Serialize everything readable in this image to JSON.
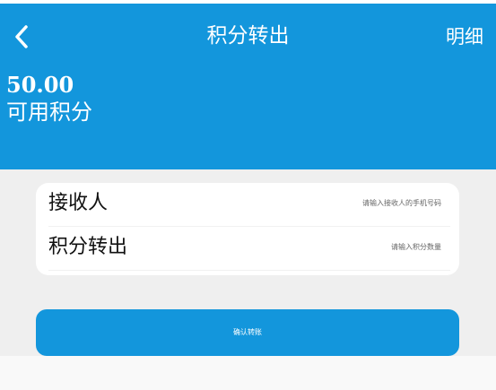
{
  "header": {
    "back_icon": "chevron-left-icon",
    "title": "积分转出",
    "detail_label": "明细",
    "background_color": "#1396dc"
  },
  "balance": {
    "value": "50.00",
    "label": "可用积分"
  },
  "form": {
    "recipient": {
      "label": "接收人",
      "value": "",
      "placeholder": "请输入接收人的手机号码"
    },
    "amount": {
      "label": "积分转出",
      "value": "",
      "placeholder": "请输入积分数量"
    }
  },
  "confirm_button": {
    "label": "确认转账",
    "color": "#1396dc"
  }
}
